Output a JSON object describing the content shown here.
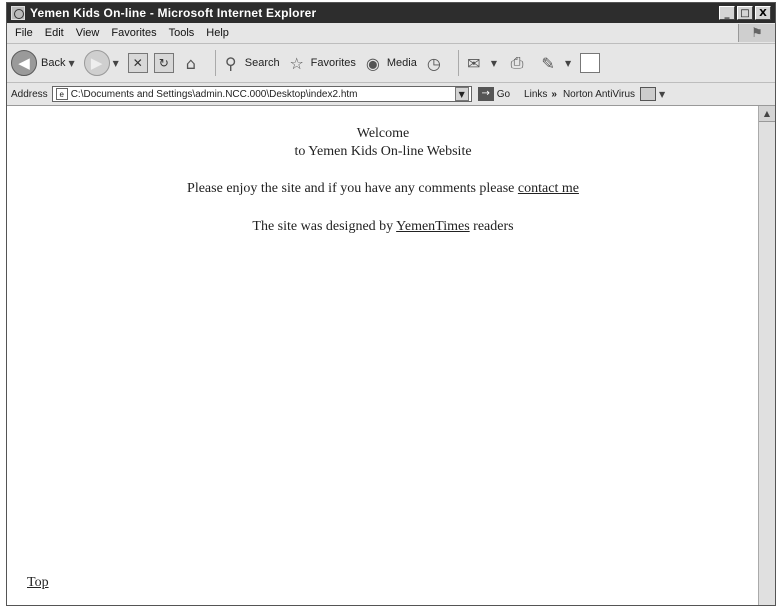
{
  "window": {
    "title": "Yemen Kids On-line - Microsoft Internet Explorer",
    "buttons": {
      "minimize": "_",
      "maximize": "□",
      "close": "X"
    }
  },
  "menu": {
    "items": [
      "File",
      "Edit",
      "View",
      "Favorites",
      "Tools",
      "Help"
    ]
  },
  "toolbar": {
    "back_label": "Back",
    "search_label": "Search",
    "favorites_label": "Favorites",
    "media_label": "Media"
  },
  "address_bar": {
    "label": "Address",
    "url": "C:\\Documents and Settings\\admin.NCC.000\\Desktop\\index2.htm",
    "go_label": "Go",
    "links_label": "Links",
    "links_chevron": "»",
    "norton_label": "Norton AntiVirus"
  },
  "page": {
    "welcome": "Welcome",
    "subtitle": "to Yemen Kids On-line Website",
    "enjoy_text": "Please enjoy the site and if you have any comments please",
    "contact_link": "contact me",
    "designed_text": "The site was designed by",
    "yementimes_link": "YemenTimes",
    "readers_text": "readers",
    "top_link": "Top"
  }
}
